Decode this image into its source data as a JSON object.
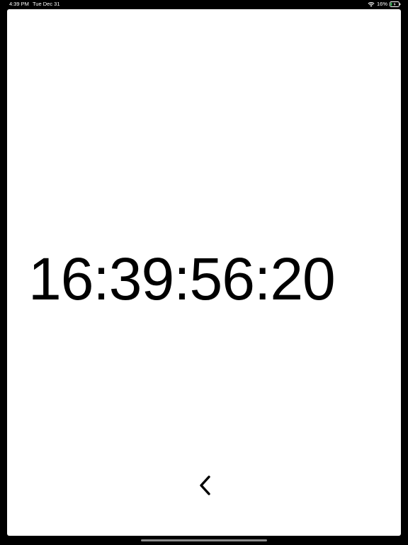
{
  "status_bar": {
    "time": "4:39 PM",
    "date": "Tue Dec 31",
    "battery_percent": "16%",
    "battery_level": 0.16,
    "wifi_icon": "wifi-icon",
    "battery_icon": "battery-icon"
  },
  "clock": {
    "display": "16:39:56:20"
  },
  "navigation": {
    "back_icon": "chevron-left-icon"
  },
  "colors": {
    "background": "#000000",
    "sheet": "#ffffff",
    "text": "#000000",
    "battery_charging": "#34c759"
  }
}
